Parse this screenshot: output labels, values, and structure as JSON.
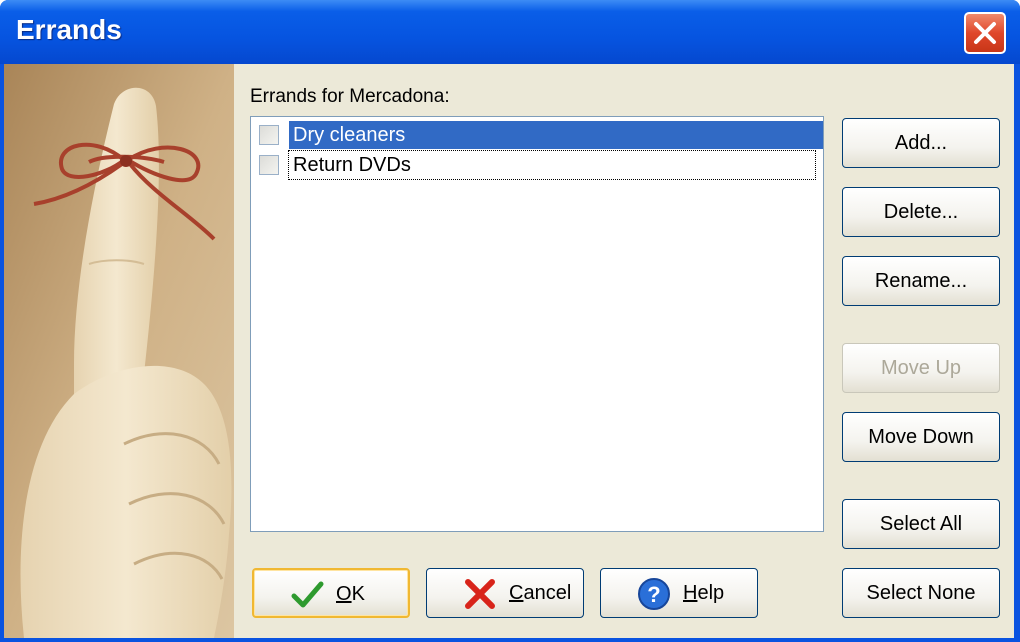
{
  "window": {
    "title": "Errands"
  },
  "list": {
    "label": "Errands for Mercadona:",
    "items": [
      {
        "text": "Dry cleaners",
        "checked": false,
        "selected": true
      },
      {
        "text": "Return DVDs",
        "checked": false,
        "selected": false
      }
    ]
  },
  "side_buttons": {
    "add": "Add...",
    "delete": "Delete...",
    "rename": "Rename...",
    "move_up": "Move Up",
    "move_down": "Move Down",
    "select_all": "Select All",
    "select_none": "Select None"
  },
  "bottom_buttons": {
    "ok_first": "O",
    "ok_rest": "K",
    "cancel_first": "C",
    "cancel_rest": "ancel",
    "help_first": "H",
    "help_rest": "elp"
  },
  "icons": {
    "close": "close-icon",
    "ok": "checkmark-icon",
    "cancel": "red-x-icon",
    "help": "question-mark-icon"
  },
  "colors": {
    "titlebar": "#0654e0",
    "selection": "#316ac5",
    "dialog_bg": "#ece9d8",
    "close_button": "#e0472a"
  }
}
